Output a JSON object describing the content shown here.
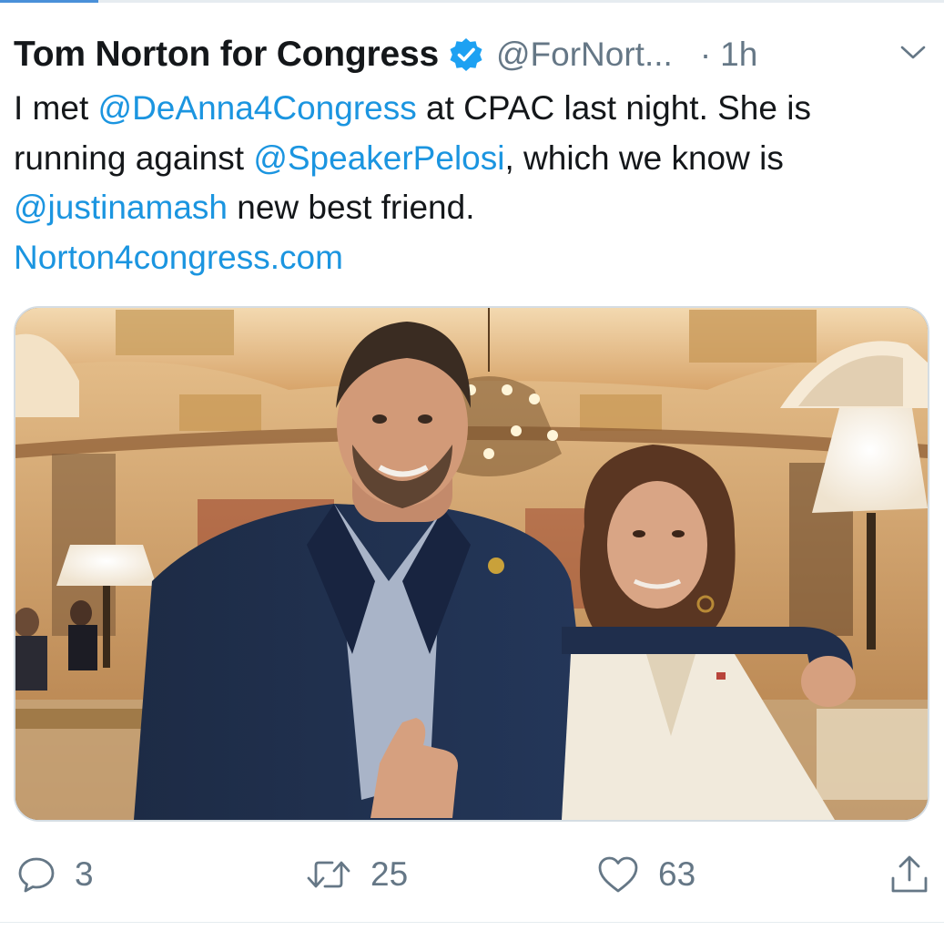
{
  "tweet": {
    "display_name": "Tom Norton for Congress",
    "verified": true,
    "handle": "@ForNort...",
    "separator": "·",
    "time": "1h",
    "text_lines": [
      [
        {
          "type": "text",
          "value": "I met "
        },
        {
          "type": "mention",
          "value": "@DeAnna4Congress"
        },
        {
          "type": "text",
          "value": " at CPAC last night. She is"
        }
      ],
      [
        {
          "type": "text",
          "value": "running against "
        },
        {
          "type": "mention",
          "value": "@SpeakerPelosi"
        },
        {
          "type": "text",
          "value": ", which we know is"
        }
      ],
      [
        {
          "type": "mention",
          "value": "@justinamash"
        },
        {
          "type": "text",
          "value": " new best friend."
        }
      ],
      [
        {
          "type": "link",
          "value": "Norton4congress.com"
        }
      ]
    ],
    "media": {
      "kind": "photo"
    }
  },
  "actions": {
    "reply_count": "3",
    "retweet_count": "25",
    "like_count": "63"
  },
  "colors": {
    "link": "#1b95e0",
    "secondary_text": "#657786",
    "primary_text": "#14171a",
    "verified_badge": "#1da1f2"
  },
  "icons": {
    "verified": "verified-badge-icon",
    "menu": "chevron-down-icon",
    "reply": "reply-icon",
    "retweet": "retweet-icon",
    "like": "heart-icon",
    "share": "share-icon"
  }
}
